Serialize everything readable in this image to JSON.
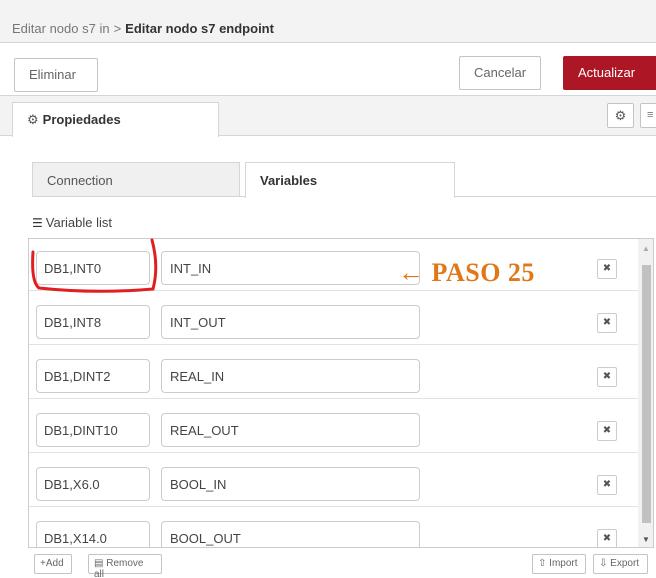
{
  "breadcrumb": {
    "parent": "Editar nodo s7 in",
    "separator": ">",
    "current": "Editar nodo s7 endpoint"
  },
  "toolbar": {
    "delete_label": "Eliminar",
    "cancel_label": "Cancelar",
    "update_label": "Actualizar",
    "accent_color": "#ad1625"
  },
  "tabs": {
    "properties_label": "Propiedades",
    "properties_icon": "gear-icon",
    "side_buttons": [
      "gear-icon",
      "document-icon"
    ]
  },
  "subtabs": [
    {
      "label": "Connection",
      "active": false
    },
    {
      "label": "Variables",
      "active": true
    }
  ],
  "variables": {
    "list_label": "Variable list",
    "list_icon": "list-icon",
    "rows": [
      {
        "address": "DB1,INT0",
        "name": "INT_IN"
      },
      {
        "address": "DB1,INT8",
        "name": "INT_OUT"
      },
      {
        "address": "DB1,DINT2",
        "name": "REAL_IN"
      },
      {
        "address": "DB1,DINT10",
        "name": "REAL_OUT"
      },
      {
        "address": "DB1,X6.0",
        "name": "BOOL_IN"
      },
      {
        "address": "DB1,X14.0",
        "name": "BOOL_OUT"
      }
    ],
    "delete_glyph": "✖"
  },
  "bottom": {
    "add_label": "Add",
    "remove_all_label": "Remove all",
    "import_label": "Import",
    "export_label": "Export"
  },
  "annotation": {
    "text": "← PASO 25",
    "color": "#e07818",
    "mark_color": "#e02020"
  }
}
